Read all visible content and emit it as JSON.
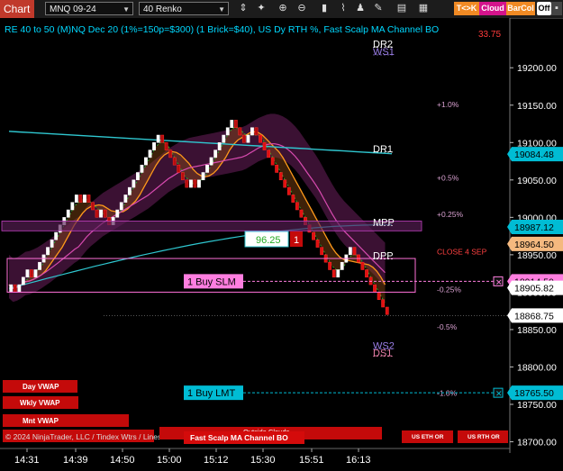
{
  "toolbar": {
    "tab_label": "Chart",
    "instrument": "MNQ 09-24",
    "bar_type": "40 Renko",
    "icons": [
      "scale-icon",
      "pointer-icon",
      "zoom-in-icon",
      "zoom-out-icon",
      "bar-style-icon",
      "indicators-icon",
      "strategies-icon",
      "drawing-tools-icon",
      "templates-icon",
      "data-box-icon"
    ],
    "buttons": {
      "tk": "T<>K",
      "cloud": "Cloud",
      "barcol": "BarCol",
      "off": "Off"
    },
    "colors": {
      "tk": "#f08a24",
      "cloud": "#d4148c",
      "barcol": "#f08a24"
    }
  },
  "header": {
    "text": "RE 40 to 50 (M)NQ Dec 20 (1%=150p=$300) (1 Brick=$40), US Dy RTH %, Fast Scalp MA Channel BO",
    "corner_value": "33.75"
  },
  "chart_data": {
    "type": "candlestick",
    "subtype": "renko",
    "brick_size": 10,
    "x_tick_labels": [
      "14:31",
      "14:39",
      "14:50",
      "15:00",
      "15:12",
      "15:30",
      "15:51",
      "16:13"
    ],
    "y_ticks": [
      18700,
      18750,
      18800,
      18850,
      18900,
      18950,
      19000,
      19050,
      19100,
      19150,
      19200
    ],
    "y_range": [
      18685,
      19240
    ],
    "renko_closes": [
      18910,
      18900,
      18910,
      18920,
      18930,
      18920,
      18930,
      18940,
      18950,
      18960,
      18970,
      18980,
      18990,
      19000,
      19010,
      19020,
      19030,
      19020,
      19030,
      19020,
      19010,
      19000,
      19010,
      19000,
      18990,
      19000,
      19010,
      19020,
      19030,
      19040,
      19050,
      19060,
      19070,
      19080,
      19090,
      19100,
      19110,
      19100,
      19090,
      19080,
      19070,
      19060,
      19050,
      19040,
      19050,
      19040,
      19050,
      19060,
      19070,
      19080,
      19090,
      19100,
      19110,
      19120,
      19130,
      19120,
      19110,
      19100,
      19110,
      19120,
      19110,
      19100,
      19090,
      19080,
      19070,
      19060,
      19050,
      19040,
      19030,
      19020,
      19010,
      19000,
      18990,
      18980,
      18970,
      18960,
      18950,
      18940,
      18930,
      18920,
      18930,
      18940,
      18950,
      18960,
      18950,
      18940,
      18930,
      18920,
      18910,
      18900,
      18890,
      18880,
      18870
    ],
    "price_axis_tags": [
      {
        "value": "19084.48",
        "color": "#00bcd4",
        "text_color": "#000000"
      },
      {
        "value": "18987.12",
        "color": "#00bcd4",
        "text_color": "#000000"
      },
      {
        "value": "18964.50",
        "color": "#f5b97f",
        "text_color": "#000000"
      },
      {
        "value": "18914.50",
        "color": "#ff7ee0",
        "text_color": "#000000"
      },
      {
        "value": "18905.82",
        "color": "#ffffff",
        "text_color": "#000000"
      },
      {
        "value": "18868.75",
        "color": "#ffffff",
        "text_color": "#000000"
      },
      {
        "value": "18765.50",
        "color": "#00bcd4",
        "text_color": "#000000"
      }
    ],
    "level_labels": [
      {
        "text": "DR2",
        "price": 19232,
        "color": "#ffffff"
      },
      {
        "text": "WS1",
        "price": 19222,
        "color": "#9b7fe8"
      },
      {
        "text": "DR1",
        "price": 19092,
        "color": "#ffffff"
      },
      {
        "text": "MPP",
        "price": 18994,
        "color": "#ffffff"
      },
      {
        "text": "DPP",
        "price": 18949,
        "color": "#ffffff"
      },
      {
        "text": "WS2",
        "price": 18829,
        "color": "#9b7fe8"
      },
      {
        "text": "DS1",
        "price": 18819,
        "color": "#e87fa8"
      }
    ],
    "percent_labels": [
      {
        "text": "+1.0%",
        "price": 19152
      },
      {
        "text": "+0.5%",
        "price": 19054
      },
      {
        "text": "+0.25%",
        "price": 19005
      },
      {
        "text": "CLOSE 4 SEP",
        "price": 18955
      },
      {
        "text": "-0.25%",
        "price": 18905
      },
      {
        "text": "-0.5%",
        "price": 18855
      },
      {
        "text": "-1.0%",
        "price": 18766
      }
    ],
    "orders": [
      {
        "label": "1 Buy SLM",
        "price": 18914.5,
        "color": "#ff7ee0"
      },
      {
        "label": "1 Buy LMT",
        "price": 18765.5,
        "color": "#00bcd4"
      }
    ],
    "position": {
      "pnl": "96.25",
      "qty": "1"
    }
  },
  "bottom_buttons": {
    "day_vwap": "Day VWAP",
    "wkly_vwap": "Wkly VWAP",
    "mnt_vwap": "Mnt VWAP",
    "outside_clouds": "Outside Clouds",
    "fast_scalp": "Fast Scalp MA Channel BO",
    "us_eth_or": "US ETH OR",
    "us_rth_or": "US RTH OR",
    "overlap_text": "© 2024 NinjaTrader, LLC / Tindex Wtrs / Lines"
  }
}
